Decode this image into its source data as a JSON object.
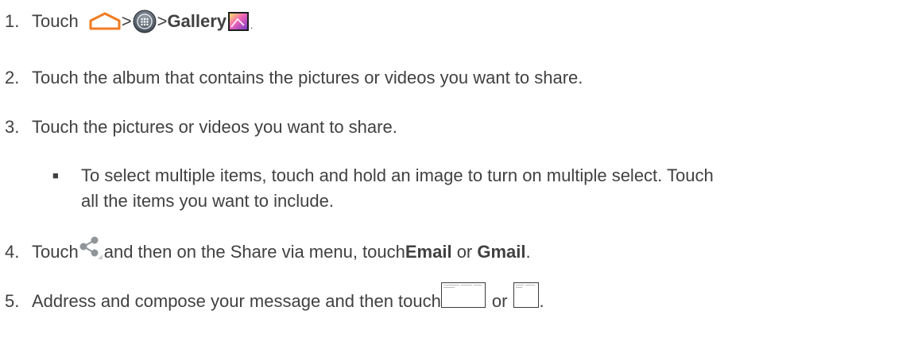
{
  "steps": [
    {
      "number": "1.",
      "touch": "Touch",
      "sep1": ">",
      "sep2": ">",
      "gallery": "Gallery",
      "end": "."
    },
    {
      "number": "2.",
      "text": "Touch the album that contains the pictures or videos you want to share."
    },
    {
      "number": "3.",
      "text": "Touch the pictures or videos you want to share."
    },
    {
      "bullet": "■",
      "line1": "To select multiple items, touch and hold an image to turn on multiple select. Touch",
      "line2": "all the items you want to include."
    },
    {
      "number": "4.",
      "touch": "Touch",
      "mid": "and then on the Share via menu, touch",
      "email": "Email",
      "or": " or ",
      "gmail": "Gmail",
      "end": "."
    },
    {
      "number": "5.",
      "text": "Address and compose your message and then touch",
      "or": "or",
      "end": "."
    }
  ],
  "icons": {
    "home": "home-icon",
    "apps": "apps-icon",
    "gallery": "gallery-icon",
    "share": "share-icon",
    "send1": "send-button-icon",
    "send2": "send-button-icon"
  }
}
